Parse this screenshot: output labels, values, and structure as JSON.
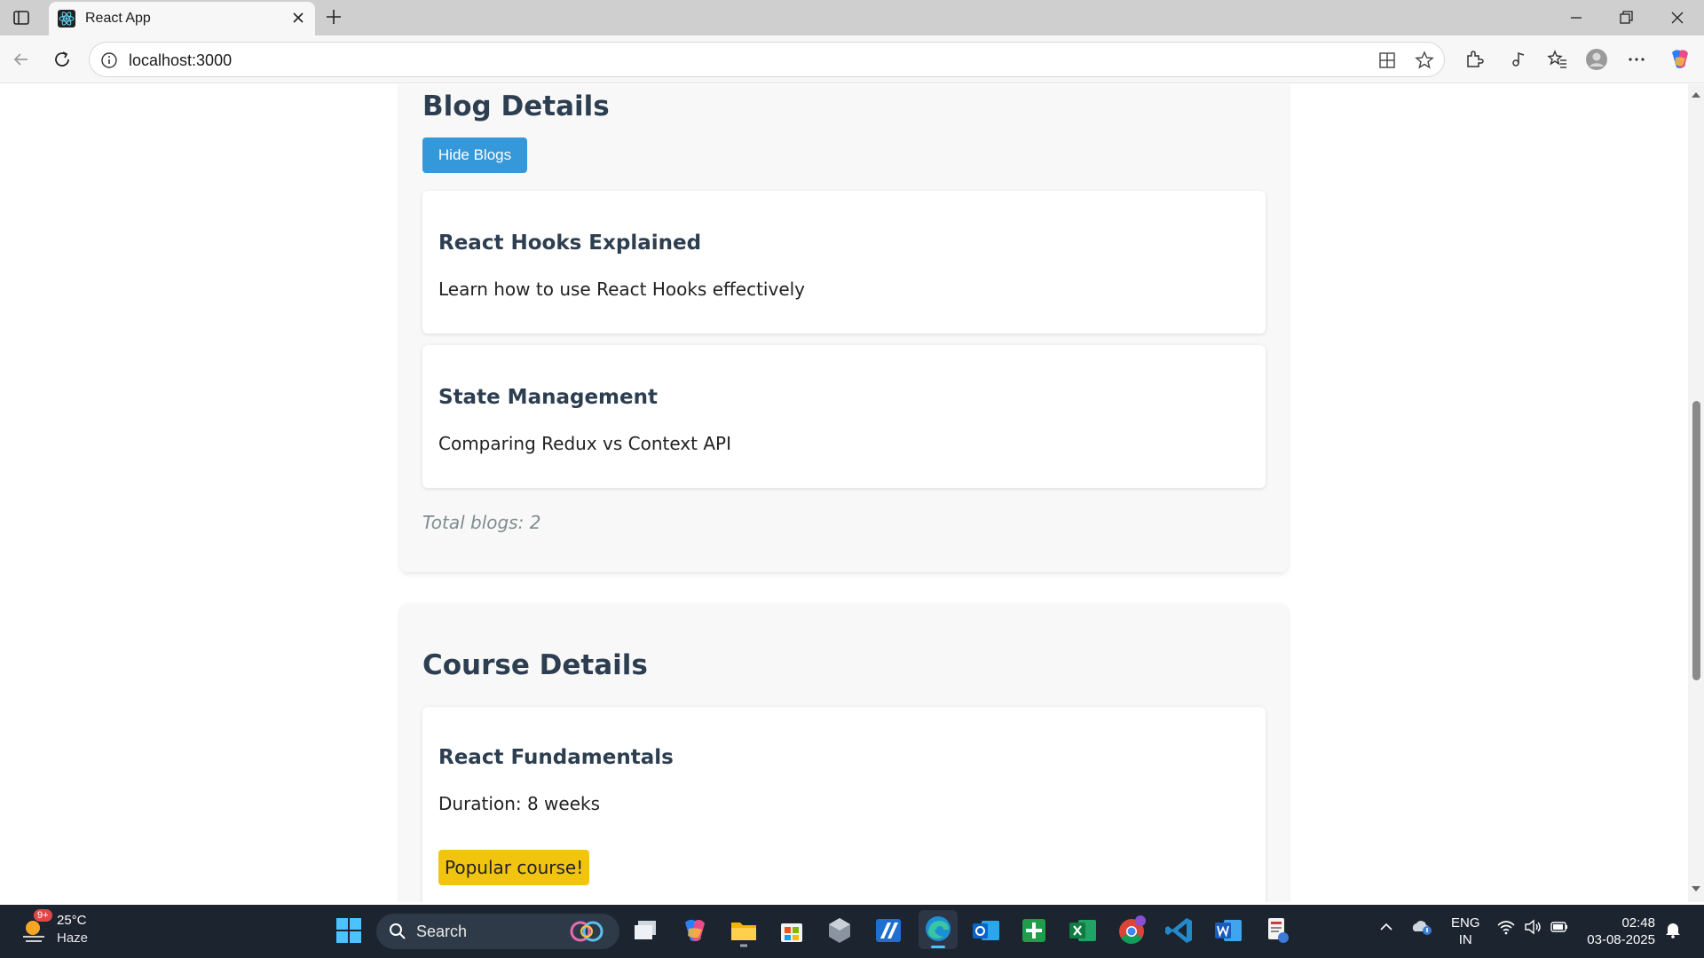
{
  "browser": {
    "tab_title": "React App",
    "url": "localhost:3000"
  },
  "page": {
    "blog_section": {
      "heading": "Blog Details",
      "toggle_button": "Hide Blogs",
      "blogs": [
        {
          "title": "React Hooks Explained",
          "description": "Learn how to use React Hooks effectively"
        },
        {
          "title": "State Management",
          "description": "Comparing Redux vs Context API"
        }
      ],
      "total": "Total blogs: 2"
    },
    "course_section": {
      "heading": "Course Details",
      "courses": [
        {
          "title": "React Fundamentals",
          "duration": "Duration: 8 weeks",
          "badge": "Popular course!"
        }
      ]
    }
  },
  "colors": {
    "heading": "#2c3e50",
    "button": "#3498db",
    "badge": "#f1c40f",
    "muted": "#7f8c8d"
  },
  "taskbar": {
    "weather_temp": "25°C",
    "weather_condition": "Haze",
    "weather_badge": "9+",
    "search_label": "Search",
    "language_line1": "ENG",
    "language_line2": "IN",
    "time": "02:48",
    "date": "03-08-2025",
    "apps": [
      "start-icon",
      "task-view-icon",
      "copilot-icon",
      "file-explorer-icon",
      "store-icon",
      "app-icon",
      "app-icon",
      "edge-icon",
      "outlook-icon",
      "app-icon",
      "excel-icon",
      "chrome-icon",
      "vscode-icon",
      "word-icon",
      "app-icon"
    ]
  }
}
